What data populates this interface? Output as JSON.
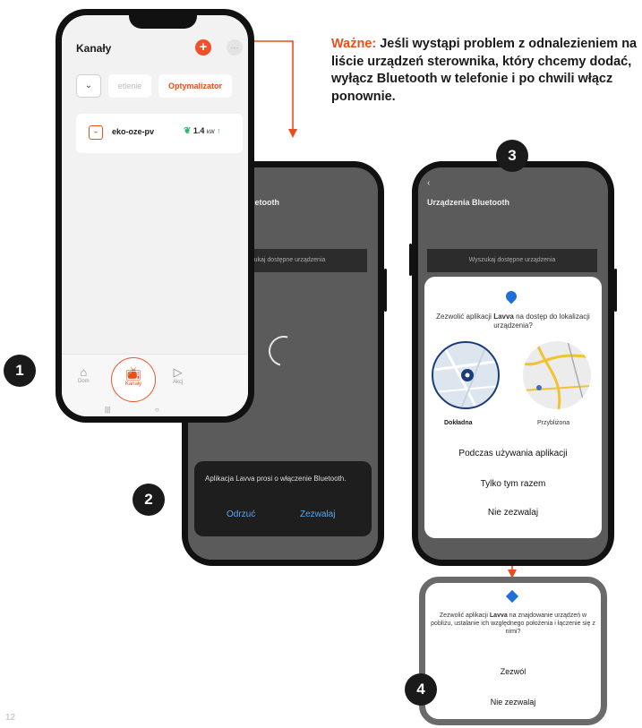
{
  "note": {
    "label": "Ważne:",
    "text": " Jeśli wystąpi problem z odnale­zieniem na liście urządzeń sterownika, który chcemy dodać, wyłącz Bluetooth w telefonie i po chwili włącz ponownie."
  },
  "steps": [
    "1",
    "2",
    "3",
    "4"
  ],
  "page_number": "12",
  "phone1": {
    "title": "Kanały",
    "plus_icon": "plus-icon",
    "more_label": "···",
    "tab_light": "etlenie",
    "tab_opt": "Optymalizator",
    "device": {
      "name": "eko-oze-pv",
      "value": "1.4",
      "unit": "kW"
    },
    "nav": {
      "home": "Dom",
      "channels": "Kanały",
      "actions": "Akcj"
    }
  },
  "phone2": {
    "title": "Urządzenia Bluetooth",
    "search": "Wyszukaj dostępne urządzenia",
    "dialog_text": "Aplikacja Lavva prosi o włączenie Bluetooth.",
    "deny": "Odrzuć",
    "allow": "Zezwalaj"
  },
  "phone3": {
    "title": "Urządzenia Bluetooth",
    "search": "Wyszukaj dostępne urządzenia",
    "q_prefix": "Zezwolić aplikacji ",
    "app": "Lavva",
    "q_suffix": " na dostęp do lokalizacji urządzenia?",
    "precise": "Dokładna",
    "approx": "Przybliżona",
    "opt1": "Podczas używania aplikacji",
    "opt2": "Tylko tym razem",
    "opt3": "Nie zezwalaj"
  },
  "phone4": {
    "q_prefix": "Zezwolić aplikacji ",
    "app": "Lavva",
    "q_suffix": " na znajdowanie urządzeń w pobliżu, ustalanie ich względnego położenia i łączenie się z nimi?",
    "allow": "Zezwól",
    "deny": "Nie zezwalaj"
  },
  "colors": {
    "accent": "#e94e1b",
    "link_blue": "#5aa7f0",
    "green": "#2bb673"
  }
}
